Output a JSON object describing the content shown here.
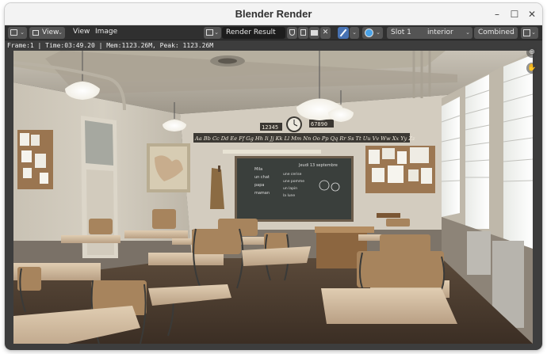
{
  "window": {
    "title": "Blender Render",
    "controls": {
      "minimize": "–",
      "maximize": "☐",
      "close": "✕"
    }
  },
  "header": {
    "editor_type_icon": "image-editor-icon",
    "view_dropdown": "View",
    "menu_view": "View",
    "menu_image": "Image",
    "image_name": "Render Result",
    "slot": "Slot 1",
    "layer": "interior",
    "pass": "Combined"
  },
  "status": {
    "info": "Frame:1 | Time:03:49.20 | Mem:1123.26M, Peak: 1123.26M"
  },
  "scene": {
    "clock_left": "12345",
    "clock_right": "67890",
    "alphabet": "Aa Bb Cc Dd Ee Ff Gg Hh Ii Jj Kk Ll Mm Nn Oo Pp Qq Rr Ss Tt Uu Vv Ww Xx Yy Zz",
    "board_date": "Jeudi 13 septembre",
    "board_lines": [
      "Mila",
      "un chat",
      "papa",
      "maman"
    ],
    "board_words": [
      "une cerise",
      "une pomme",
      "un lapin",
      "la lune"
    ]
  },
  "colors": {
    "blender_header": "#303030",
    "blender_button": "#545454",
    "blender_active": "#4772b3",
    "viewport_bg": "#3d3d3d"
  }
}
